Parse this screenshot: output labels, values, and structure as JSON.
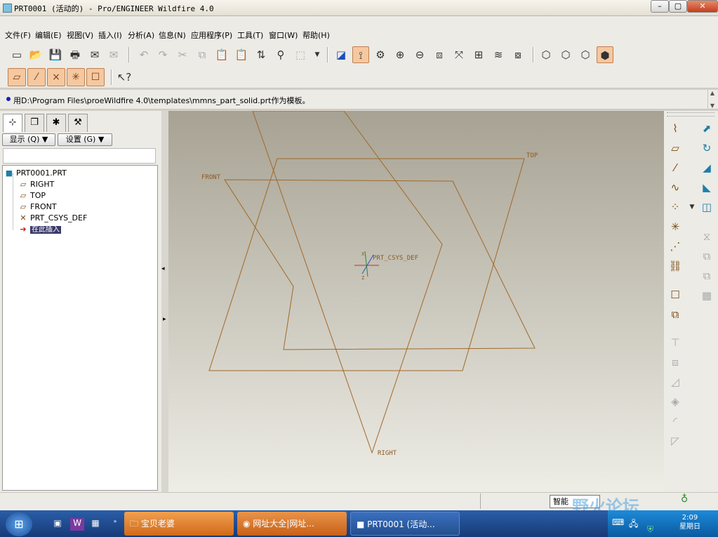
{
  "window": {
    "title": "PRT0001 (活动的) - Pro/ENGINEER Wildfire 4.0",
    "minimize": "–",
    "maximize": "▢",
    "close": "✕"
  },
  "menu": [
    "文件(F)",
    "编辑(E)",
    "视图(V)",
    "插入(I)",
    "分析(A)",
    "信息(N)",
    "应用程序(P)",
    "工具(T)",
    "窗口(W)",
    "帮助(H)"
  ],
  "message": "用D:\\Program Files\\proeWildfire 4.0\\templates\\mmns_part_solid.prt作为模板。",
  "left_panel": {
    "display_button": "显示 (Q) ▼",
    "settings_button": "设置 (G) ▼",
    "tree": [
      {
        "label": "PRT0001.PRT",
        "icon": "part-icon"
      },
      {
        "label": "RIGHT",
        "icon": "datum-plane-icon"
      },
      {
        "label": "TOP",
        "icon": "datum-plane-icon"
      },
      {
        "label": "FRONT",
        "icon": "datum-plane-icon"
      },
      {
        "label": "PRT_CSYS_DEF",
        "icon": "csys-icon"
      },
      {
        "label": "在此插入",
        "icon": "insert-arrow-icon"
      }
    ]
  },
  "graphics": {
    "labels": {
      "top": "TOP",
      "front": "FRONT",
      "right": "RIGHT",
      "csys": "PRT_CSYS_DEF",
      "axis_z": "Z",
      "axis_x": "X"
    },
    "color": "#a0692a",
    "background_top": "#a7a293",
    "background_bottom": "#eeede6"
  },
  "status": {
    "mode": "智能",
    "watermark": "野火论坛"
  },
  "taskbar": {
    "tasks": [
      "宝贝老婆",
      "网址大全|网址...",
      "PRT0001 (活动..."
    ],
    "clock_time": "2:09",
    "clock_day": "星期日"
  }
}
